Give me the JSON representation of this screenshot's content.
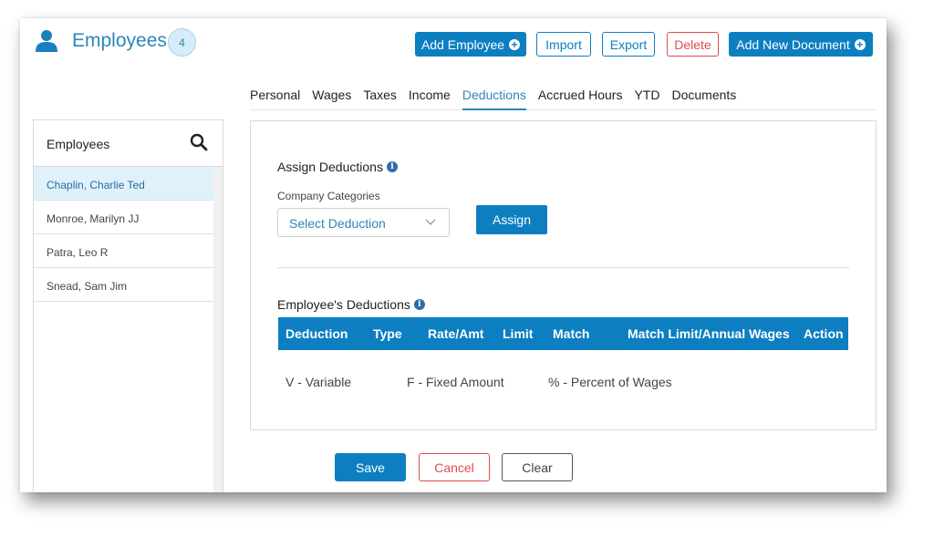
{
  "header": {
    "title": "Employees",
    "count": "4",
    "buttons": {
      "add_employee": "Add Employee",
      "import": "Import",
      "export": "Export",
      "delete": "Delete",
      "add_document": "Add New Document"
    }
  },
  "tabs": [
    "Personal",
    "Wages",
    "Taxes",
    "Income",
    "Deductions",
    "Accrued Hours",
    "YTD",
    "Documents"
  ],
  "active_tab": "Deductions",
  "sidebar": {
    "title": "Employees",
    "employees": [
      "Chaplin, Charlie Ted",
      "Monroe, Marilyn JJ",
      "Patra, Leo R",
      "Snead, Sam Jim"
    ],
    "selected": "Chaplin, Charlie Ted"
  },
  "assign": {
    "title": "Assign Deductions",
    "field_label": "Company Categories",
    "select_placeholder": "Select Deduction",
    "assign_button": "Assign"
  },
  "deductions": {
    "title": "Employee's Deductions",
    "columns": [
      "Deduction",
      "Type",
      "Rate/Amt",
      "Limit",
      "Match",
      "Match Limit/Annual Wages",
      "Action"
    ],
    "rows": [],
    "legend": [
      "V - Variable",
      "F - Fixed Amount",
      "% - Percent of Wages"
    ]
  },
  "footer": {
    "save": "Save",
    "cancel": "Cancel",
    "clear": "Clear"
  },
  "colors": {
    "primary": "#0d7fc1",
    "accent_text": "#2e86b8",
    "danger": "#e14b4b",
    "selected_row": "#e1f1fb"
  }
}
